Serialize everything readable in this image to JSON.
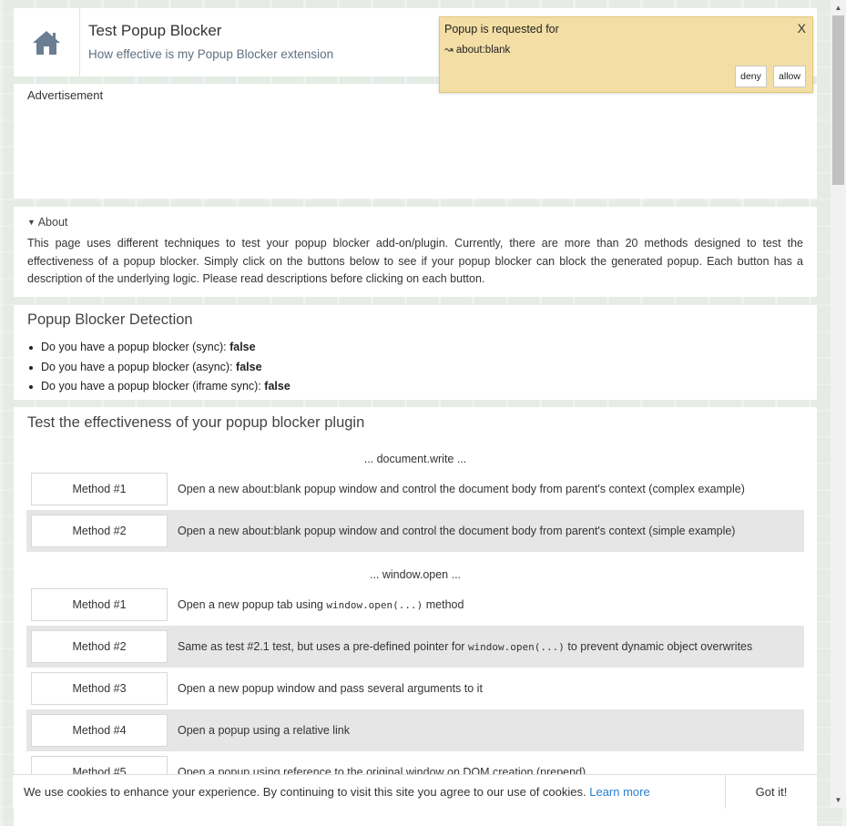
{
  "header": {
    "home_icon": "home-icon",
    "title": "Test Popup Blocker",
    "subtitle": "How effective is my Popup Blocker extension"
  },
  "ad": {
    "label": "Advertisement"
  },
  "about": {
    "summary": "About",
    "marker": "▼",
    "text": "This page uses different techniques to test your popup blocker add-on/plugin. Currently, there are more than 20 methods designed to test the effectiveness of a popup blocker. Simply click on the buttons below to see if your popup blocker can block the generated popup. Each button has a description of the underlying logic. Please read descriptions before clicking on each button."
  },
  "detection": {
    "heading": "Popup Blocker Detection",
    "items": [
      {
        "label": "Do you have a popup blocker (sync):",
        "value": "false"
      },
      {
        "label": "Do you have a popup blocker (async):",
        "value": "false"
      },
      {
        "label": "Do you have a popup blocker (iframe sync):",
        "value": "false"
      }
    ]
  },
  "tests": {
    "heading": "Test the effectiveness of your popup blocker plugin",
    "document_write": {
      "label": "... document.write ...",
      "methods": [
        {
          "button": "Method #1",
          "desc": "Open a new about:blank popup window and control the document body from parent's context (complex example)"
        },
        {
          "button": "Method #2",
          "desc": "Open a new about:blank popup window and control the document body from parent's context (simple example)"
        }
      ]
    },
    "window_open": {
      "label": "... window.open ...",
      "methods": [
        {
          "button": "Method #1",
          "desc_pre": "Open a new popup tab using ",
          "desc_code": "window.open(...)",
          "desc_post": " method"
        },
        {
          "button": "Method #2",
          "desc_pre": "Same as test #2.1 test, but uses a pre-defined pointer for ",
          "desc_code": "window.open(...)",
          "desc_post": " to prevent dynamic object overwrites"
        },
        {
          "button": "Method #3",
          "desc": "Open a new popup window and pass several arguments to it"
        },
        {
          "button": "Method #4",
          "desc": "Open a popup using a relative link"
        },
        {
          "button": "Method #5",
          "desc": "Open a popup using reference to the original window on DOM creation (prepend)"
        }
      ]
    }
  },
  "popup_notification": {
    "title": "Popup is requested for",
    "url": "↝ about:blank",
    "close": "X",
    "deny": "deny",
    "allow": "allow",
    "background": "#f3dfa5"
  },
  "cookie": {
    "text": "We use cookies to enhance your experience. By continuing to visit this site you agree to our use of cookies.",
    "link": "Learn more",
    "button": "Got it!",
    "link_color": "#2a7fd4"
  },
  "scrollbar": {
    "up": "▲",
    "down": "▼"
  }
}
